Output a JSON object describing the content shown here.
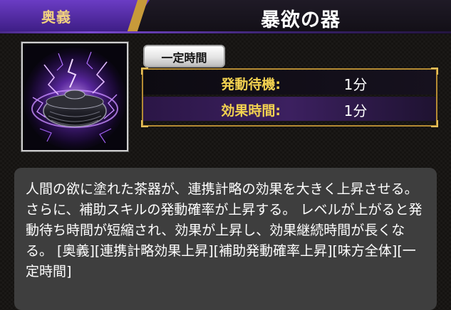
{
  "header": {
    "tag": "奥義",
    "title": "暴欲の器"
  },
  "skill": {
    "icon": "purple-lightning-incense-burner-icon",
    "badge": "一定時間",
    "stats": [
      {
        "label": "発動待機:",
        "value": "1分"
      },
      {
        "label": "効果時間:",
        "value": "1分"
      }
    ]
  },
  "description": "人間の欲に塗れた茶器が、連携計略の効果を大きく上昇させる。さらに、補助スキルの発動確率が上昇する。 レベルが上がると発動待ち時間が短縮され、効果が上昇し、効果継続時間が長くなる。 [奥義][連携計略効果上昇][補助発動確率上昇][味方全体][一定時間]",
  "colors": {
    "accent_purple": "#5a2fb0",
    "gold": "#f3d250",
    "panel": "#3e3e3e"
  }
}
